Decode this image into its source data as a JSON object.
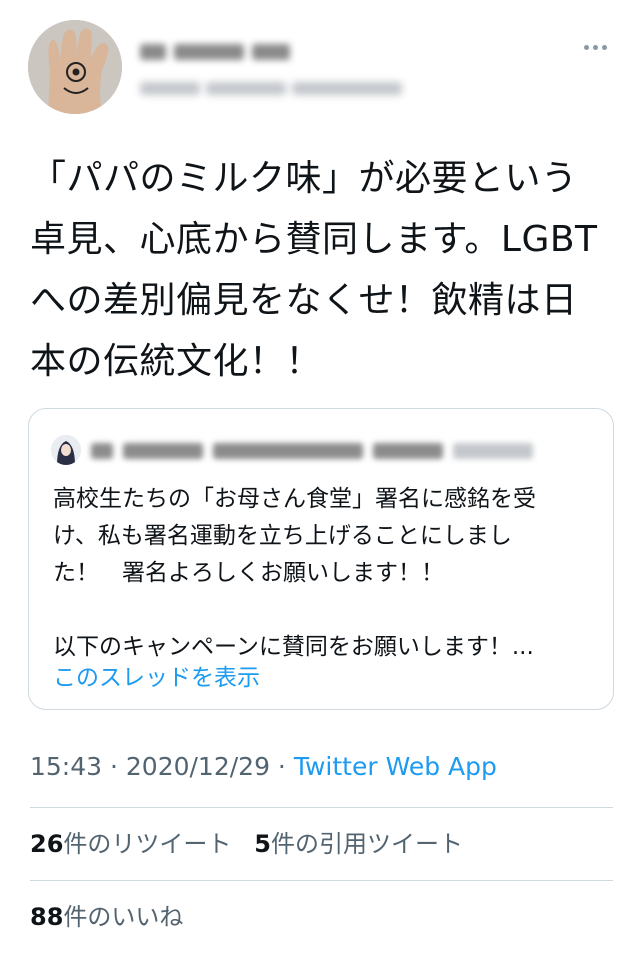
{
  "tweet": {
    "text_lines": [
      "「パパのミルク味」が必要という",
      "卓見、心底から賛同します。LGBT",
      "への差別偏見をなくせ！飲精は日",
      "本の伝統文化！！"
    ]
  },
  "quote": {
    "text": "高校生たちの「お母さん食堂」署名に感銘を受\nけ、私も署名運動を立ち上げることにしまし\nた！　署名よろしくお願いします！！\n\n以下のキャンペーンに賛同をお願いします！...",
    "show_thread": "このスレッドを表示"
  },
  "meta": {
    "time": "15:43",
    "separator": " · ",
    "date": "2020/12/29",
    "app": "Twitter Web App"
  },
  "stats": {
    "retweets_count": "26",
    "retweets_label": "件のリツイート",
    "quotes_count": "5",
    "quotes_label": "件の引用ツイート",
    "likes_count": "88",
    "likes_label": "件のいいね"
  },
  "colors": {
    "link": "#1d9bf0",
    "secondary_text": "#536471",
    "divider": "#cfd9de"
  },
  "icons": {
    "more": "more-horizontal-icon"
  }
}
